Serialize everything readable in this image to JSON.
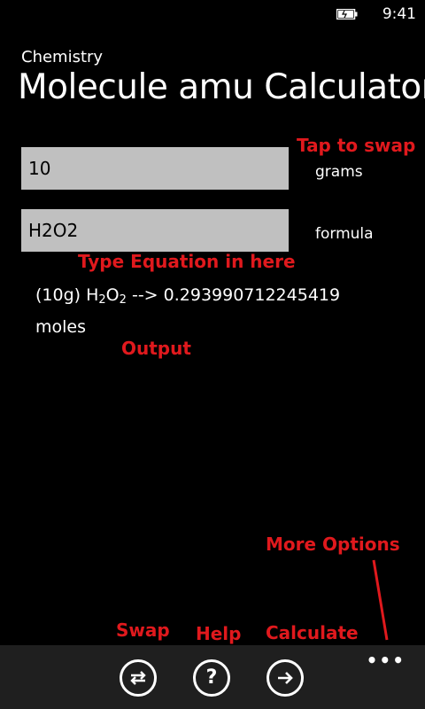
{
  "status": {
    "time": "9:41"
  },
  "app": {
    "name": "Chemistry",
    "title": "Molecule amu Calculator"
  },
  "inputs": {
    "amount_value": "10",
    "amount_unit": "grams",
    "formula_value": "H2O2",
    "formula_unit": "formula"
  },
  "output": {
    "prefix": "(10g) H",
    "sub1": "2",
    "mid": "O",
    "sub2": "2",
    "suffix": " --> 0.293990712245419 moles"
  },
  "annotations": {
    "tap_to_swap": "Tap to swap",
    "type_equation": "Type Equation in here",
    "output": "Output",
    "more_options": "More Options",
    "swap": "Swap",
    "help": "Help",
    "calculate": "Calculate"
  },
  "appbar": {
    "more_dots": "•••"
  },
  "colors": {
    "annotation": "#e0191d",
    "textbox": "#c0c0c0",
    "appbar": "#1f1f1f"
  }
}
